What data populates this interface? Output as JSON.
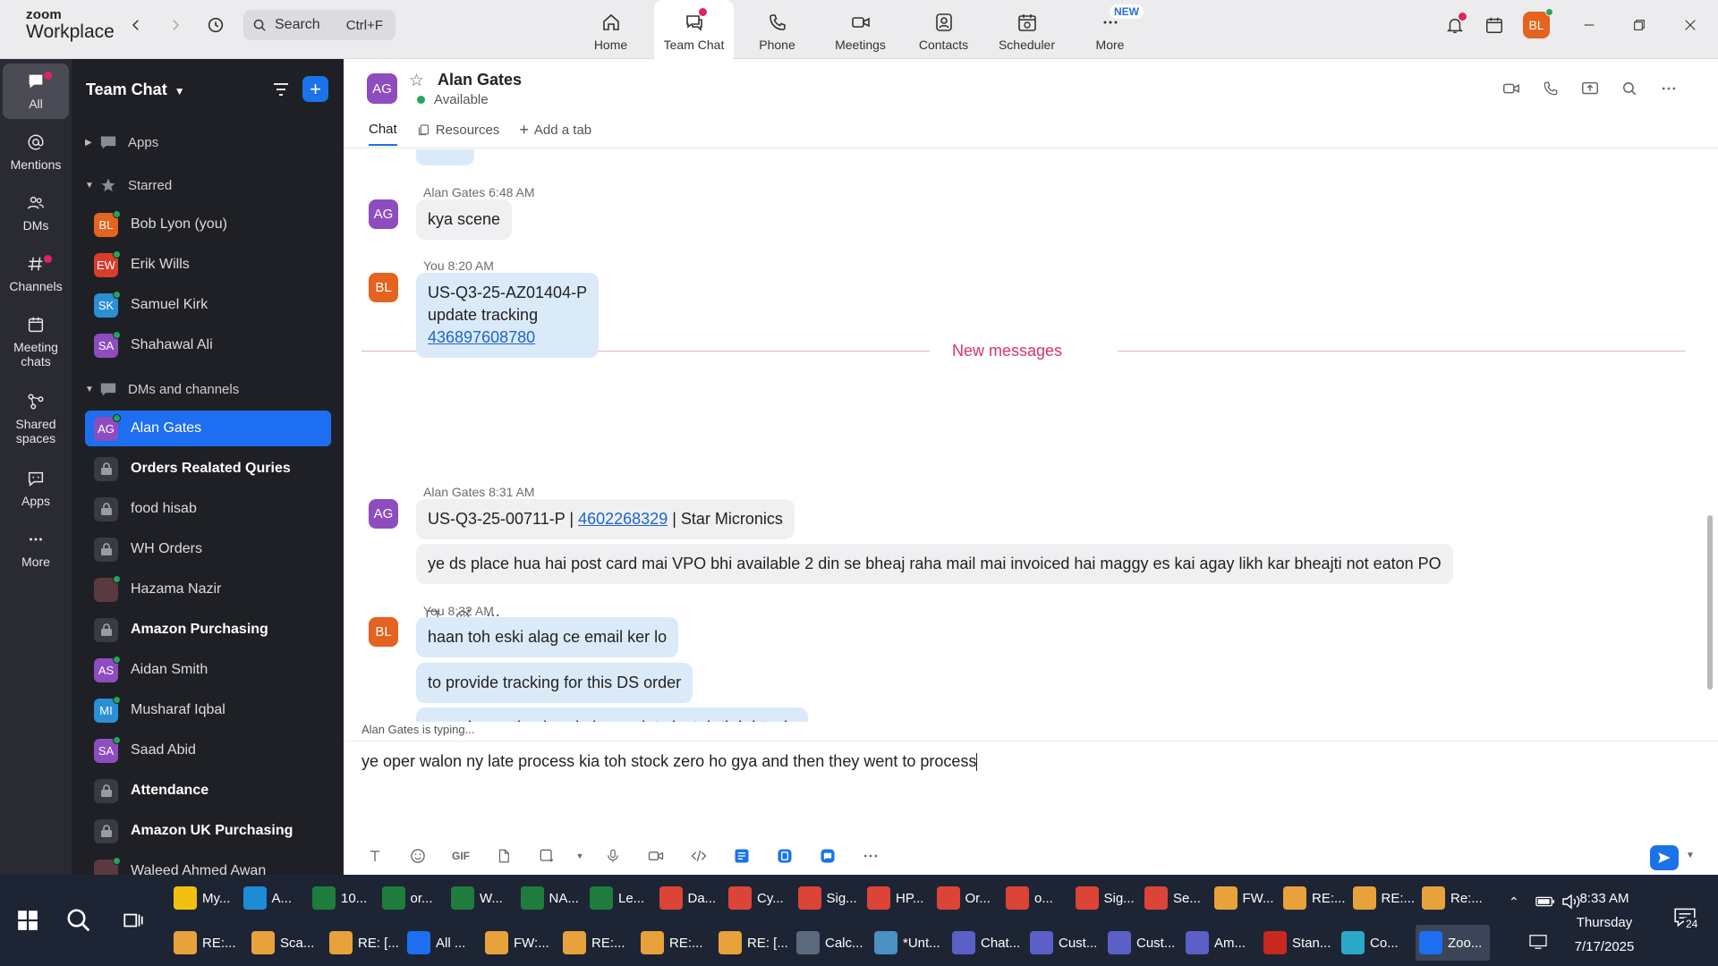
{
  "topbar": {
    "logo_line1": "zoom",
    "logo_line2": "Workplace",
    "search_placeholder": "Search",
    "search_shortcut": "Ctrl+F",
    "nav": [
      {
        "label": "Home"
      },
      {
        "label": "Team Chat"
      },
      {
        "label": "Phone"
      },
      {
        "label": "Meetings"
      },
      {
        "label": "Contacts"
      },
      {
        "label": "Scheduler"
      },
      {
        "label": "More",
        "badge": "NEW"
      }
    ],
    "user_initials": "BL"
  },
  "rail": [
    {
      "label": "All"
    },
    {
      "label": "Mentions"
    },
    {
      "label": "DMs"
    },
    {
      "label": "Channels"
    },
    {
      "label": "Meeting chats"
    },
    {
      "label": "Shared spaces"
    },
    {
      "label": "Apps"
    },
    {
      "label": "More"
    }
  ],
  "sidebar": {
    "title": "Team Chat",
    "sections": {
      "apps": "Apps",
      "starred": "Starred",
      "dms": "DMs and channels"
    },
    "starred": [
      {
        "initials": "BL",
        "name": "Bob Lyon (you)",
        "color": "#e3631f"
      },
      {
        "initials": "EW",
        "name": "Erik Wills",
        "color": "#d93d2b"
      },
      {
        "initials": "SK",
        "name": "Samuel Kirk",
        "color": "#2b8fd6"
      },
      {
        "initials": "SA",
        "name": "Shahawal Ali",
        "color": "#8e4dbf"
      }
    ],
    "dms": [
      {
        "initials": "AG",
        "name": "Alan Gates",
        "color": "#8e4dbf",
        "type": "user"
      },
      {
        "name": "Orders Realated Quries",
        "type": "channel",
        "bold": true
      },
      {
        "name": "food hisab",
        "type": "channel"
      },
      {
        "name": "WH Orders",
        "type": "channel"
      },
      {
        "name": "Hazama Nazir",
        "type": "photo"
      },
      {
        "name": "Amazon Purchasing",
        "type": "channel",
        "bold": true
      },
      {
        "initials": "AS",
        "name": "Aidan Smith",
        "color": "#8e4dbf",
        "type": "user"
      },
      {
        "initials": "MI",
        "name": "Musharaf Iqbal",
        "color": "#2b8fd6",
        "type": "user"
      },
      {
        "initials": "SA",
        "name": "Saad Abid",
        "color": "#8e4dbf",
        "type": "user"
      },
      {
        "name": "Attendance",
        "type": "channel",
        "bold": true
      },
      {
        "name": "Amazon UK Purchasing",
        "type": "channel",
        "bold": true
      },
      {
        "name": "Waleed Ahmed Awan",
        "type": "photo"
      }
    ]
  },
  "chat": {
    "contact_initials": "AG",
    "contact_name": "Alan Gates",
    "contact_status": "Available",
    "tabs": [
      "Chat",
      "Resources",
      "Add a tab"
    ],
    "new_messages_label": "New messages",
    "typing_text": "Alan Gates is typing...",
    "groups": [
      {
        "sender": "Alan Gates",
        "time": "6:48 AM",
        "initials": "AG",
        "color": "#8e4dbf",
        "mine": false,
        "messages": [
          [
            "kya scene"
          ]
        ]
      },
      {
        "sender": "You",
        "time": "8:20 AM",
        "initials": "BL",
        "color": "#e3631f",
        "mine": true,
        "messages": [
          [
            "US-Q3-25-AZ01404-P",
            "update tracking",
            "436897608780"
          ]
        ]
      },
      {
        "sender": "Alan Gates",
        "time": "8:31 AM",
        "initials": "AG",
        "color": "#8e4dbf",
        "mine": false,
        "messages": [
          {
            "pre": "US-Q3-25-00711-P | ",
            "link": "4602268329",
            "post": " | Star Micronics"
          },
          [
            "ye ds place hua hai post card mai VPO bhi available 2 din se bheaj raha mail mai invoiced hai maggy es kai agay likh kar bheajti not eaton PO"
          ]
        ]
      },
      {
        "sender": "You",
        "time": "8:32 AM",
        "initials": "BL",
        "color": "#e3631f",
        "mine": true,
        "messages": [
          [
            "haan toh eski alag ce email ker lo"
          ],
          [
            "to provide tracking for this DS order"
          ],
          [
            "or ye b mention ker do k agar late hy toh tb b bta de"
          ]
        ]
      }
    ],
    "composer_text": "ye oper walon ny late process kia toh stock zero ho gya and then they went to process"
  },
  "taskbar": {
    "row1": [
      {
        "label": "My...",
        "color": "#f2c012"
      },
      {
        "label": "A...",
        "color": "#1d8bd6"
      },
      {
        "label": "10...",
        "color": "#1e7d3c"
      },
      {
        "label": "or...",
        "color": "#1e7d3c"
      },
      {
        "label": "W...",
        "color": "#1e7d3c"
      },
      {
        "label": "NA...",
        "color": "#1e7d3c"
      },
      {
        "label": "Le...",
        "color": "#1e7d3c"
      },
      {
        "label": "Da...",
        "color": "#db4437"
      },
      {
        "label": "Cy...",
        "color": "#db4437"
      },
      {
        "label": "Sig...",
        "color": "#db4437"
      },
      {
        "label": "HP...",
        "color": "#db4437"
      },
      {
        "label": "Or...",
        "color": "#db4437"
      },
      {
        "label": "o...",
        "color": "#db4437"
      },
      {
        "label": "Sig...",
        "color": "#db4437"
      },
      {
        "label": "Se...",
        "color": "#db4437"
      },
      {
        "label": "FW...",
        "color": "#e8a23c"
      },
      {
        "label": "RE:...",
        "color": "#e8a23c"
      },
      {
        "label": "RE:...",
        "color": "#e8a23c"
      },
      {
        "label": "Re:...",
        "color": "#e8a23c"
      }
    ],
    "row2": [
      {
        "label": "RE:...",
        "color": "#e8a23c"
      },
      {
        "label": "Sca...",
        "color": "#e8a23c"
      },
      {
        "label": "RE: [...",
        "color": "#e8a23c"
      },
      {
        "label": "All ...",
        "color": "#1d6ef0"
      },
      {
        "label": "FW:...",
        "color": "#e8a23c"
      },
      {
        "label": "RE:...",
        "color": "#e8a23c"
      },
      {
        "label": "RE:...",
        "color": "#e8a23c"
      },
      {
        "label": "RE: [...",
        "color": "#e8a23c"
      },
      {
        "label": "Calc...",
        "color": "#5d6a7d"
      },
      {
        "label": "*Unt...",
        "color": "#4a90c2"
      },
      {
        "label": "Chat...",
        "color": "#5b5fc7"
      },
      {
        "label": "Cust...",
        "color": "#5b5fc7"
      },
      {
        "label": "Cust...",
        "color": "#5b5fc7"
      },
      {
        "label": "Am...",
        "color": "#5b5fc7"
      },
      {
        "label": "Stan...",
        "color": "#c8281e"
      },
      {
        "label": "Co...",
        "color": "#2aa8c7"
      },
      {
        "label": "Zoo...",
        "color": "#1d6ef0"
      }
    ],
    "time": "8:33 AM",
    "day": "Thursday",
    "date": "7/17/2025",
    "notif_count": "24"
  }
}
